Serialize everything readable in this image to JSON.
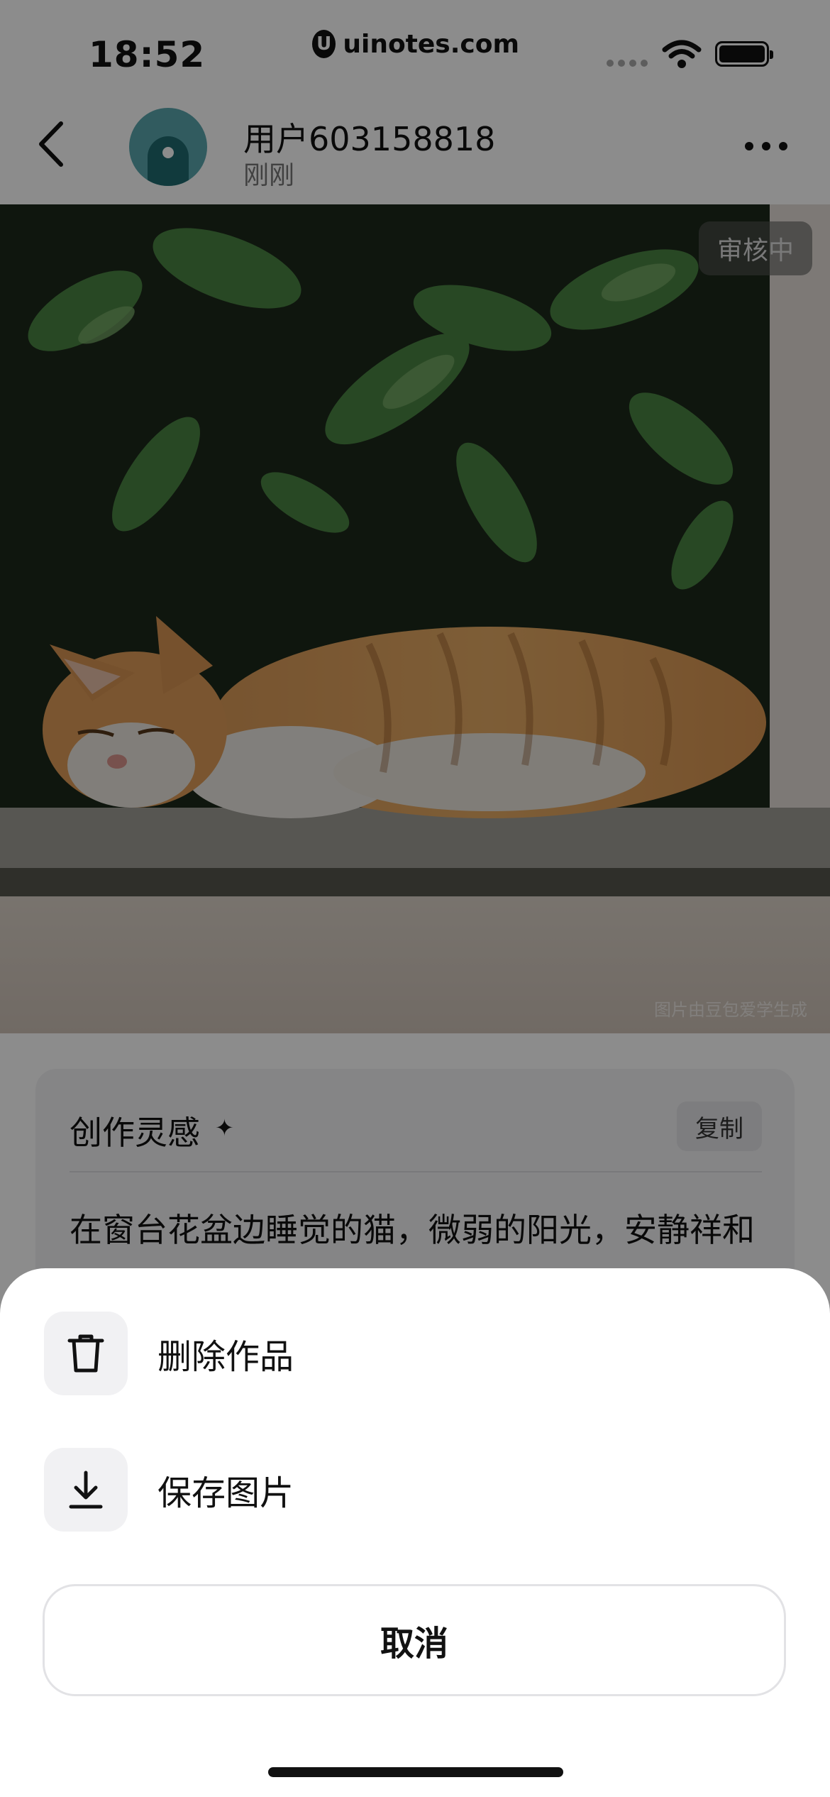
{
  "status_bar": {
    "time": "18:52",
    "url": "uinotes.com",
    "url_logo": "U"
  },
  "header": {
    "user_name": "用户603158818",
    "post_time": "刚刚"
  },
  "photo": {
    "review_badge": "审核中",
    "watermark": "图片由豆包爱学生成"
  },
  "inspiration": {
    "title": "创作灵感",
    "sparkle": "✦",
    "copy_label": "复制",
    "prompt": "在窗台花盆边睡觉的猫，微弱的阳光，安静祥和"
  },
  "action_sheet": {
    "delete_label": "删除作品",
    "save_label": "保存图片",
    "cancel_label": "取消"
  },
  "icons": {
    "back": "chevron-left-icon",
    "more": "more-horizontal-icon",
    "delete": "trash-icon",
    "save": "download-icon",
    "sparkle": "sparkle-icon"
  },
  "colors": {
    "overlay": "#000000",
    "sheet_background": "#ffffff",
    "icon_box": "#f1f1f3",
    "card_background": "#f3f3f5"
  }
}
